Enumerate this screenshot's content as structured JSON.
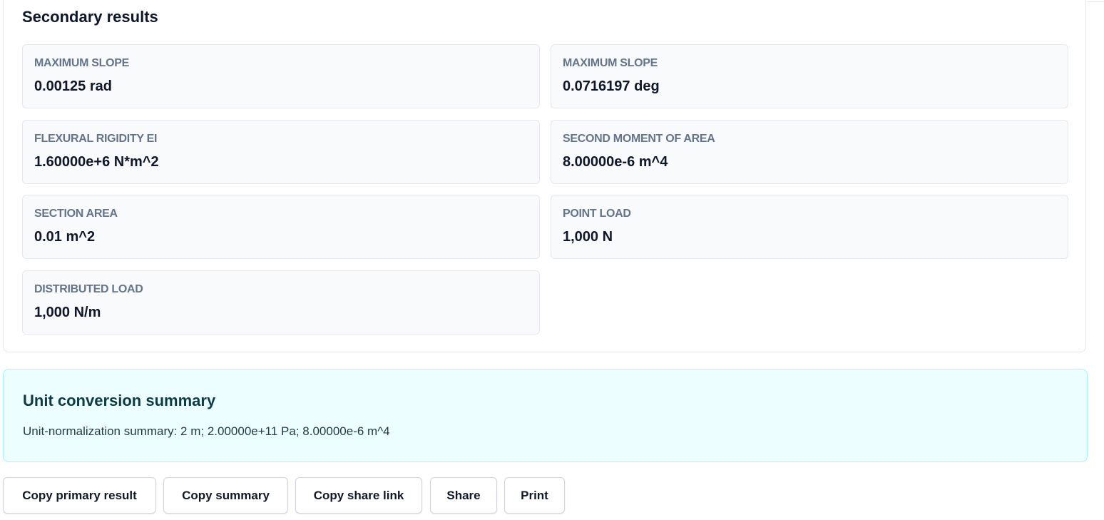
{
  "secondary_results": {
    "title": "Secondary results",
    "metrics": [
      {
        "label": "MAXIMUM SLOPE",
        "value": "0.00125 rad"
      },
      {
        "label": "MAXIMUM SLOPE",
        "value": "0.0716197 deg"
      },
      {
        "label": "FLEXURAL RIGIDITY EI",
        "value": "1.60000e+6 N*m^2"
      },
      {
        "label": "SECOND MOMENT OF AREA",
        "value": "8.00000e-6 m^4"
      },
      {
        "label": "SECTION AREA",
        "value": "0.01 m^2"
      },
      {
        "label": "POINT LOAD",
        "value": "1,000 N"
      },
      {
        "label": "DISTRIBUTED LOAD",
        "value": "1,000 N/m"
      }
    ]
  },
  "unit_summary": {
    "title": "Unit conversion summary",
    "text": "Unit-normalization summary: 2 m; 2.00000e+11 Pa; 8.00000e-6 m^4"
  },
  "actions": {
    "copy_primary": "Copy primary result",
    "copy_summary": "Copy summary",
    "copy_share_link": "Copy share link",
    "share": "Share",
    "print": "Print"
  },
  "colors": {
    "card_border": "#e5e7eb",
    "metric_bg": "#f8fafc",
    "summary_bg": "#ecfeff",
    "summary_border": "#a5f3fc"
  }
}
